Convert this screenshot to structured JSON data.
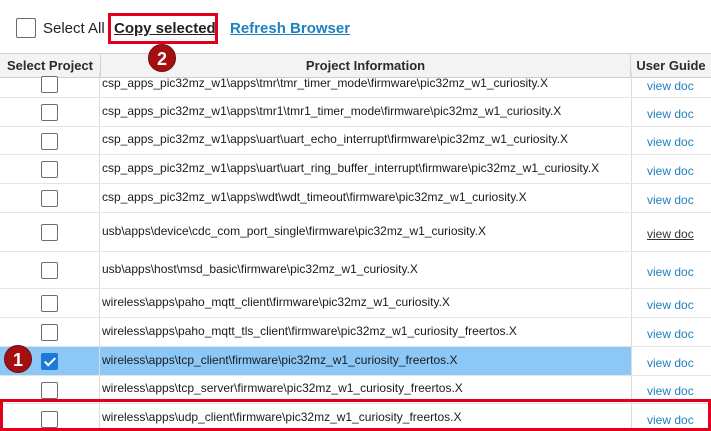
{
  "toolbar": {
    "select_all_label": "Select All",
    "copy_selected_label": "Copy selected",
    "refresh_label": "Refresh Browser"
  },
  "annotations": {
    "badge_1": "1",
    "badge_2": "2"
  },
  "columns": [
    "Select Project",
    "Project Information",
    "User Guide"
  ],
  "rows": [
    {
      "info": "csp_apps_pic32mz_w1\\apps\\tmr\\tmr_timer_mode\\firmware\\pic32mz_w1_curiosity.X",
      "guide": "view doc",
      "checked": false
    },
    {
      "info": "csp_apps_pic32mz_w1\\apps\\tmr1\\tmr1_timer_mode\\firmware\\pic32mz_w1_curiosity.X",
      "guide": "view doc",
      "checked": false
    },
    {
      "info": "csp_apps_pic32mz_w1\\apps\\uart\\uart_echo_interrupt\\firmware\\pic32mz_w1_curiosity.X",
      "guide": "view doc",
      "checked": false
    },
    {
      "info": "csp_apps_pic32mz_w1\\apps\\uart\\uart_ring_buffer_interrupt\\firmware\\pic32mz_w1_curiosity.X",
      "guide": "view doc",
      "checked": false
    },
    {
      "info": "csp_apps_pic32mz_w1\\apps\\wdt\\wdt_timeout\\firmware\\pic32mz_w1_curiosity.X",
      "guide": "view doc",
      "checked": false
    },
    {
      "info": "usb\\apps\\device\\cdc_com_port_single\\firmware\\pic32mz_w1_curiosity.X",
      "guide": "view doc",
      "checked": false
    },
    {
      "info": "usb\\apps\\host\\msd_basic\\firmware\\pic32mz_w1_curiosity.X",
      "guide": "view doc",
      "checked": false
    },
    {
      "info": "wireless\\apps\\paho_mqtt_client\\firmware\\pic32mz_w1_curiosity.X",
      "guide": "view doc",
      "checked": false
    },
    {
      "info": "wireless\\apps\\paho_mqtt_tls_client\\firmware\\pic32mz_w1_curiosity_freertos.X",
      "guide": "view doc",
      "checked": false
    },
    {
      "info": "wireless\\apps\\tcp_client\\firmware\\pic32mz_w1_curiosity_freertos.X",
      "guide": "view doc",
      "checked": true
    },
    {
      "info": "wireless\\apps\\tcp_server\\firmware\\pic32mz_w1_curiosity_freertos.X",
      "guide": "view doc",
      "checked": false
    },
    {
      "info": "wireless\\apps\\udp_client\\firmware\\pic32mz_w1_curiosity_freertos.X",
      "guide": "view doc",
      "checked": false
    }
  ]
}
